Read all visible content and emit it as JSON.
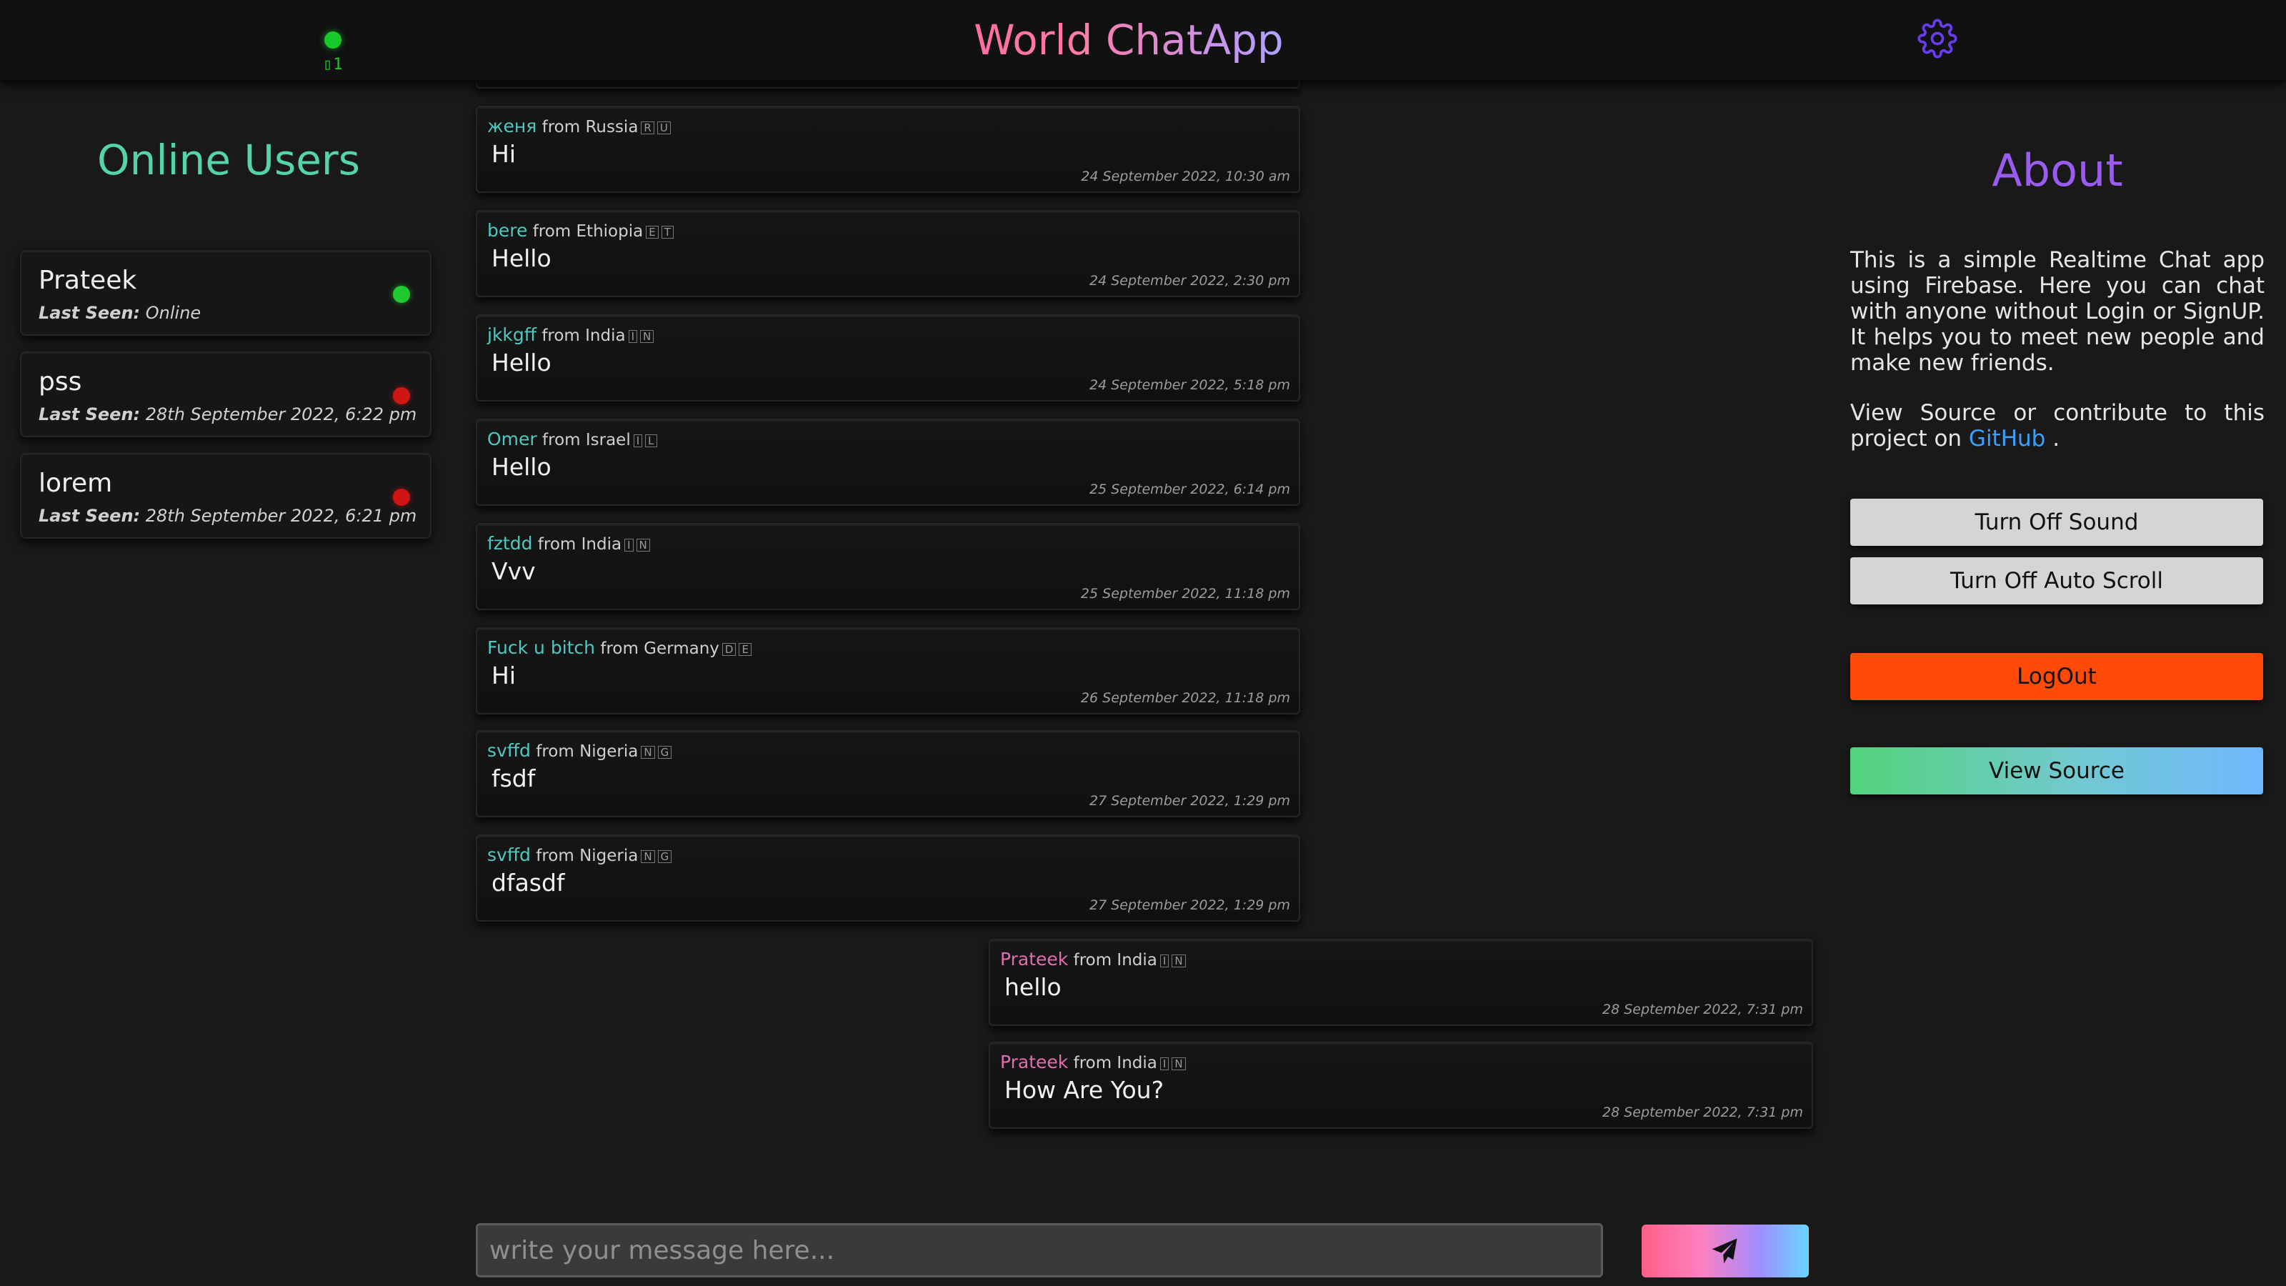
{
  "header": {
    "title": "World ChatApp",
    "connection_count": "1",
    "settings_icon": "gear-icon"
  },
  "online_users": {
    "title": "Online Users",
    "last_seen_label": "Last Seen:",
    "users": [
      {
        "name": "Prateek",
        "last_seen": "Online",
        "status": "online"
      },
      {
        "name": "pss",
        "last_seen": "28th September 2022, 6:22 pm",
        "status": "offline"
      },
      {
        "name": "lorem",
        "last_seen": "28th September 2022, 6:21 pm",
        "status": "offline"
      }
    ]
  },
  "messages": [
    {
      "sender": "женя",
      "from": "from Russia",
      "flag": [
        "R",
        "U"
      ],
      "text": "Hi",
      "time": "24 September 2022, 10:30 am",
      "side": "left"
    },
    {
      "sender": "bere",
      "from": "from Ethiopia",
      "flag": [
        "E",
        "T"
      ],
      "text": "Hello",
      "time": "24 September 2022, 2:30 pm",
      "side": "left"
    },
    {
      "sender": "jkkgff",
      "from": "from India",
      "flag": [
        "I",
        "N"
      ],
      "text": "Hello",
      "time": "24 September 2022, 5:18 pm",
      "side": "left"
    },
    {
      "sender": "Omer",
      "from": "from Israel",
      "flag": [
        "I",
        "L"
      ],
      "text": "Hello",
      "time": "25 September 2022, 6:14 pm",
      "side": "left"
    },
    {
      "sender": "fztdd",
      "from": "from India",
      "flag": [
        "I",
        "N"
      ],
      "text": "Vvv",
      "time": "25 September 2022, 11:18 pm",
      "side": "left"
    },
    {
      "sender": "Fuck u bitch",
      "from": "from Germany",
      "flag": [
        "D",
        "E"
      ],
      "text": "Hi",
      "time": "26 September 2022, 11:18 pm",
      "side": "left"
    },
    {
      "sender": "svffd",
      "from": "from Nigeria",
      "flag": [
        "N",
        "G"
      ],
      "text": "fsdf",
      "time": "27 September 2022, 1:29 pm",
      "side": "left"
    },
    {
      "sender": "svffd",
      "from": "from Nigeria",
      "flag": [
        "N",
        "G"
      ],
      "text": "dfasdf",
      "time": "27 September 2022, 1:29 pm",
      "side": "left"
    },
    {
      "sender": "Prateek",
      "from": "from India",
      "flag": [
        "I",
        "N"
      ],
      "text": "hello",
      "time": "28 September 2022, 7:31 pm",
      "side": "right"
    },
    {
      "sender": "Prateek",
      "from": "from India",
      "flag": [
        "I",
        "N"
      ],
      "text": "How Are You?",
      "time": "28 September 2022, 7:31 pm",
      "side": "right"
    }
  ],
  "composer": {
    "placeholder": "write your message here...",
    "send_icon": "paper-plane-icon"
  },
  "about": {
    "title": "About",
    "description": "This is a simple Realtime Chat app using Firebase. Here you can chat with anyone without Login or SignUP. It helps you to meet new people and make new friends.",
    "source_text_before": "View Source or contribute to this project on",
    "source_link": "GitHub",
    "source_text_after": ".",
    "buttons": {
      "sound": "Turn Off Sound",
      "autoscroll": "Turn Off Auto Scroll",
      "logout": "LogOut",
      "view_source": "View Source"
    }
  },
  "colors": {
    "background": "#191919",
    "header": "#111111",
    "online": "#1fc92f",
    "offline": "#d01515",
    "about_title": "#9a5cf0",
    "online_title": "#55d4a8",
    "logout": "#ff4a08",
    "link": "#3aa0ff"
  }
}
